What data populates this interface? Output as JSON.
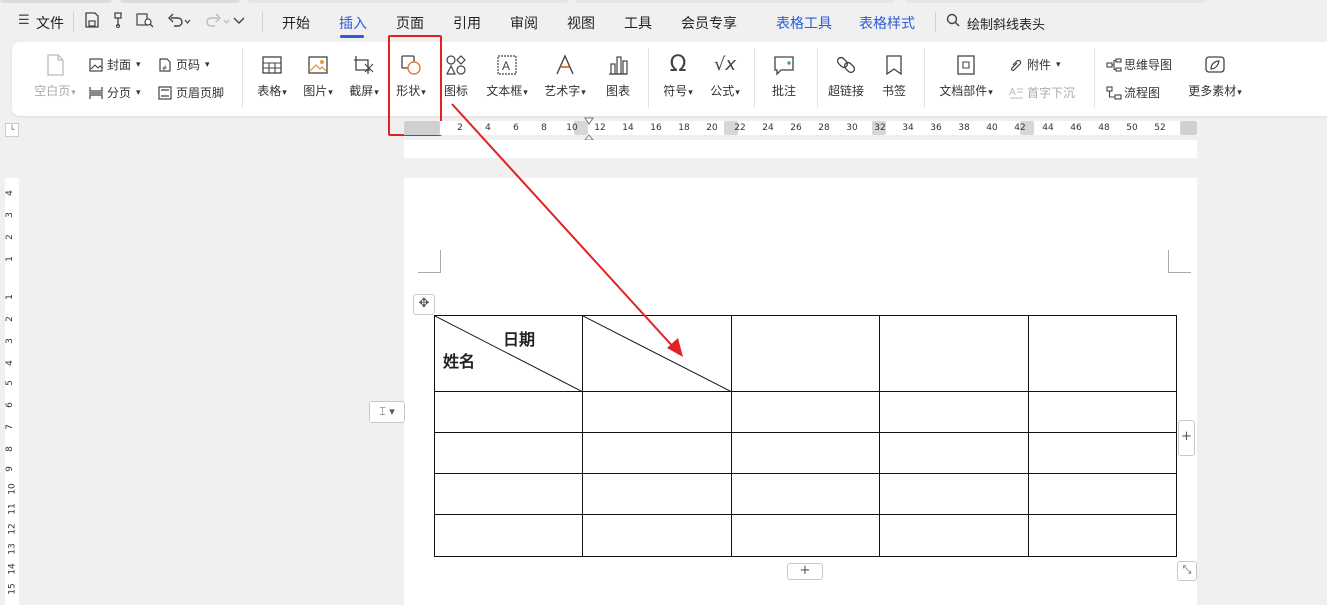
{
  "menu": {
    "file": "文件",
    "tabs": [
      "开始",
      "插入",
      "页面",
      "引用",
      "审阅",
      "视图",
      "工具",
      "会员专享"
    ],
    "active_tab": "插入",
    "context_tabs": [
      "表格工具",
      "表格样式"
    ],
    "search_text": "绘制斜线表头"
  },
  "ribbon": {
    "blank_page": "空白页",
    "cover": "封面",
    "page_break": "分页",
    "page_number": "页码",
    "header_footer": "页眉页脚",
    "table": "表格",
    "picture": "图片",
    "screenshot": "截屏",
    "shape": "形状",
    "icon": "图标",
    "textbox": "文本框",
    "wordart": "艺术字",
    "chart": "图表",
    "symbol": "符号",
    "formula": "公式",
    "comment": "批注",
    "hyperlink": "超链接",
    "bookmark": "书签",
    "doc_parts": "文档部件",
    "attachment": "附件",
    "drop_cap": "首字下沉",
    "mindmap": "思维导图",
    "flowchart": "流程图",
    "more_assets": "更多素材"
  },
  "ruler": {
    "ticks": [
      "2",
      "4",
      "6",
      "8",
      "10",
      "12",
      "14",
      "16",
      "18",
      "20",
      "22",
      "24",
      "26",
      "28",
      "30",
      "32",
      "34",
      "36",
      "38",
      "40",
      "42",
      "44",
      "46",
      "48",
      "50",
      "52"
    ],
    "vticks": [
      "4",
      "3",
      "2",
      "1",
      "1",
      "2",
      "3",
      "4",
      "5",
      "6",
      "7",
      "8",
      "9",
      "10",
      "11",
      "12",
      "13",
      "14",
      "15"
    ]
  },
  "table": {
    "header_top": "日期",
    "header_bottom": "姓名",
    "rows": 5,
    "cols": 5
  },
  "annotation": {
    "color": "#e22222"
  }
}
